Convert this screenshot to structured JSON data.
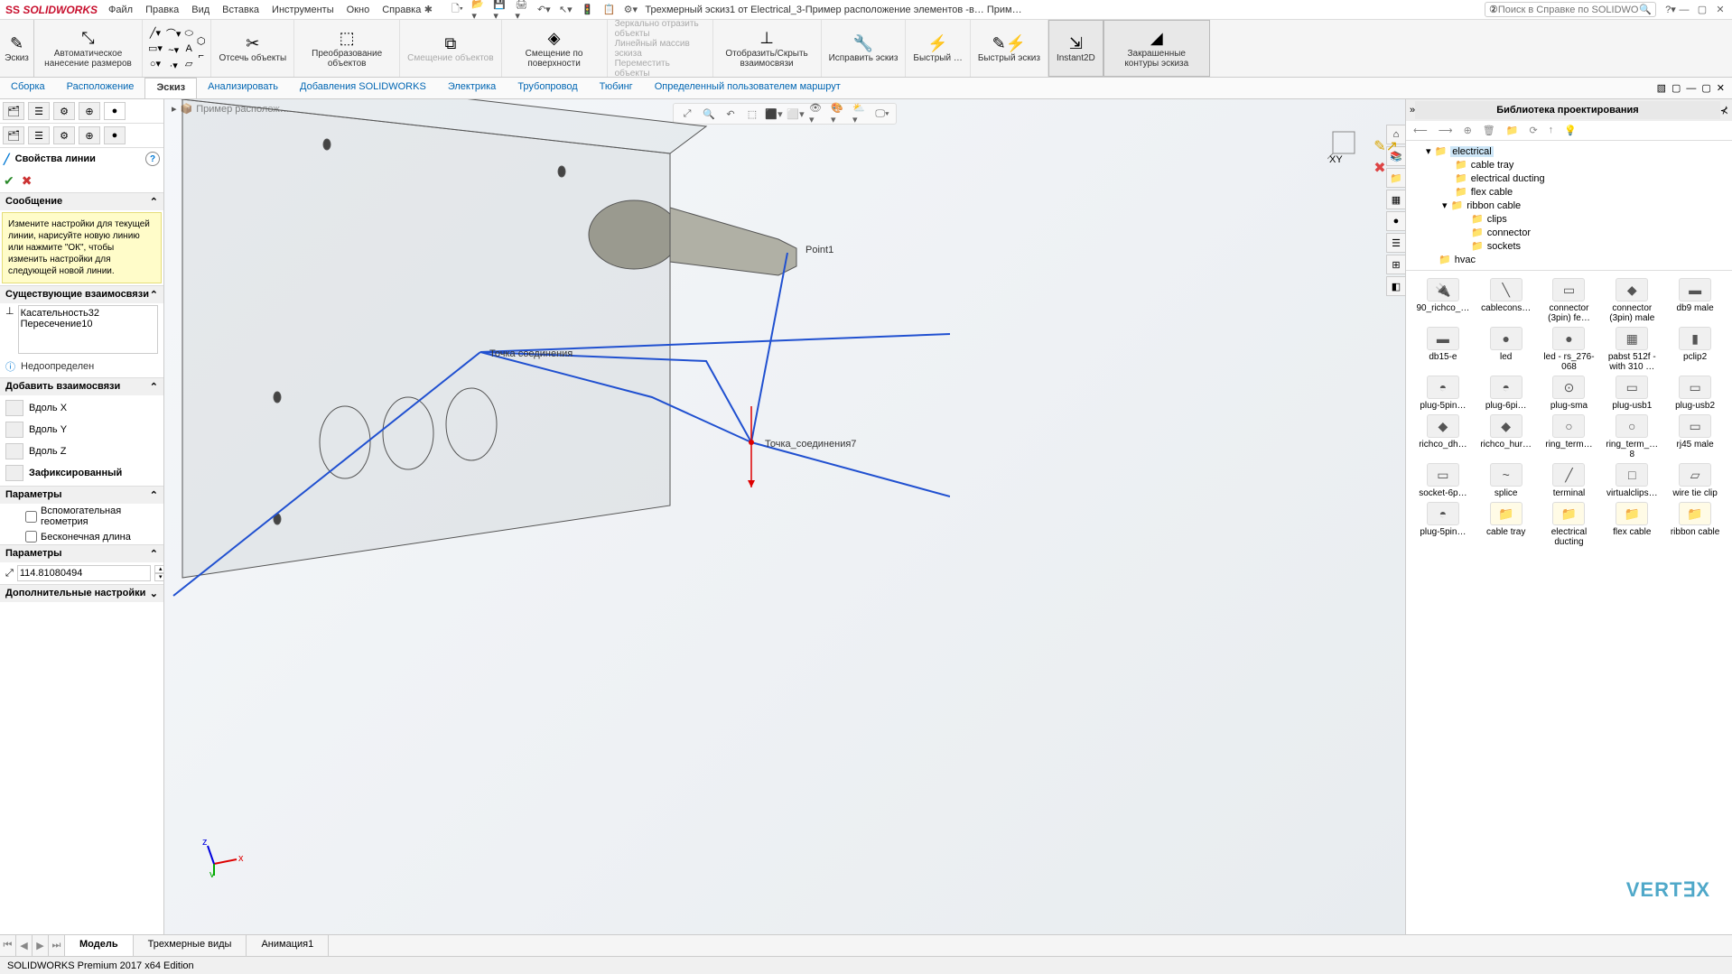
{
  "app": {
    "logo": "SOLIDWORKS",
    "doc_title": "Трехмерный эскиз1 от Electrical_3-Пример расположение элементов -в… Прим…"
  },
  "menu": [
    "Файл",
    "Правка",
    "Вид",
    "Вставка",
    "Инструменты",
    "Окно",
    "Справка"
  ],
  "search_placeholder": "Поиск в Справке по SOLIDWORKS",
  "ribbon": {
    "sketch": "Эскиз",
    "auto_dim": "Автоматическое нанесение размеров",
    "trim": "Отсечь объекты",
    "convert": "Преобразование объектов",
    "offset": "Смещение объектов",
    "offset_surface": "Смещение по поверхности",
    "mirror": "Зеркально отразить объекты",
    "linear": "Линейный массив эскиза",
    "move": "Переместить объекты",
    "relations": "Отобразить/Скрыть взаимосвязи",
    "repair": "Исправить эскиз",
    "rapid": "Быстрый …",
    "rapid_sketch": "Быстрый эскиз",
    "instant": "Instant2D",
    "shaded": "Закрашенные контуры эскиза"
  },
  "tabs": [
    "Сборка",
    "Расположение",
    "Эскиз",
    "Анализировать",
    "Добавления SOLIDWORKS",
    "Электрика",
    "Трубопровод",
    "Тюбинг",
    "Определенный пользователем маршрут"
  ],
  "tabs_active": 2,
  "breadcrumb": "Пример располож…",
  "prop": {
    "title": "Свойства линии",
    "msg_head": "Сообщение",
    "message": "Измените настройки для текущей линии, нарисуйте новую линию или нажмите \"ОК\", чтобы изменить настройки для следующей новой линии.",
    "existing_head": "Существующие взаимосвязи",
    "relations": [
      "Касательность32",
      "Пересечение10"
    ],
    "under_defined": "Недоопределен",
    "add_head": "Добавить взаимосвязи",
    "along_x": "Вдоль X",
    "along_y": "Вдоль Y",
    "along_z": "Вдоль Z",
    "fixed": "Зафиксированный",
    "params_head": "Параметры",
    "aux_geom": "Вспомогательная геометрия",
    "infinite": "Бесконечная длина",
    "params_head2": "Параметры",
    "length_val": "114.81080494",
    "more_head": "Дополнительные настройки"
  },
  "viewport": {
    "point1": "Point1",
    "cp7": "Точка_соединения7",
    "cp2": "Точка соединения"
  },
  "lib": {
    "title": "Библиотека проектирования",
    "tree": [
      {
        "label": "electrical",
        "lvl": 1,
        "open": true,
        "selected": true
      },
      {
        "label": "cable tray",
        "lvl": 2
      },
      {
        "label": "electrical ducting",
        "lvl": 2
      },
      {
        "label": "flex cable",
        "lvl": 2
      },
      {
        "label": "ribbon cable",
        "lvl": 2,
        "open": true
      },
      {
        "label": "clips",
        "lvl": 3
      },
      {
        "label": "connector",
        "lvl": 3
      },
      {
        "label": "sockets",
        "lvl": 3
      },
      {
        "label": "hvac",
        "lvl": 1
      }
    ],
    "items": [
      {
        "n": "90_richco_…",
        "i": "🔌"
      },
      {
        "n": "cablecons…",
        "i": "╲"
      },
      {
        "n": "connector (3pin) fe…",
        "i": "▭"
      },
      {
        "n": "connector (3pin) male",
        "i": "◆"
      },
      {
        "n": "db9 male",
        "i": "▬"
      },
      {
        "n": "db15-e",
        "i": "▬"
      },
      {
        "n": "led",
        "i": "●"
      },
      {
        "n": "led - rs_276-068",
        "i": "●"
      },
      {
        "n": "pabst 512f - with 310 …",
        "i": "▦"
      },
      {
        "n": "pclip2",
        "i": "▮"
      },
      {
        "n": "plug-5pin…",
        "i": "◓"
      },
      {
        "n": "plug-6pi…",
        "i": "◓"
      },
      {
        "n": "plug-sma",
        "i": "⊙"
      },
      {
        "n": "plug-usb1",
        "i": "▭"
      },
      {
        "n": "plug-usb2",
        "i": "▭"
      },
      {
        "n": "richco_dh…",
        "i": "◆"
      },
      {
        "n": "richco_hur…",
        "i": "◆"
      },
      {
        "n": "ring_term…",
        "i": "○"
      },
      {
        "n": "ring_term_… 8",
        "i": "○"
      },
      {
        "n": "rj45 male",
        "i": "▭"
      },
      {
        "n": "socket-6p…",
        "i": "▭"
      },
      {
        "n": "splice",
        "i": "~"
      },
      {
        "n": "terminal",
        "i": "╱"
      },
      {
        "n": "virtualclips…",
        "i": "□"
      },
      {
        "n": "wire tie clip",
        "i": "▱"
      },
      {
        "n": "plug-5pin…",
        "i": "◓"
      },
      {
        "n": "cable tray",
        "i": "📁",
        "f": true
      },
      {
        "n": "electrical ducting",
        "i": "📁",
        "f": true
      },
      {
        "n": "flex cable",
        "i": "📁",
        "f": true
      },
      {
        "n": "ribbon cable",
        "i": "📁",
        "f": true
      }
    ]
  },
  "bottom_tabs": [
    "Модель",
    "Трехмерные виды",
    "Анимация1"
  ],
  "status": "SOLIDWORKS Premium 2017 x64 Edition",
  "vertex": "VERT∃X"
}
